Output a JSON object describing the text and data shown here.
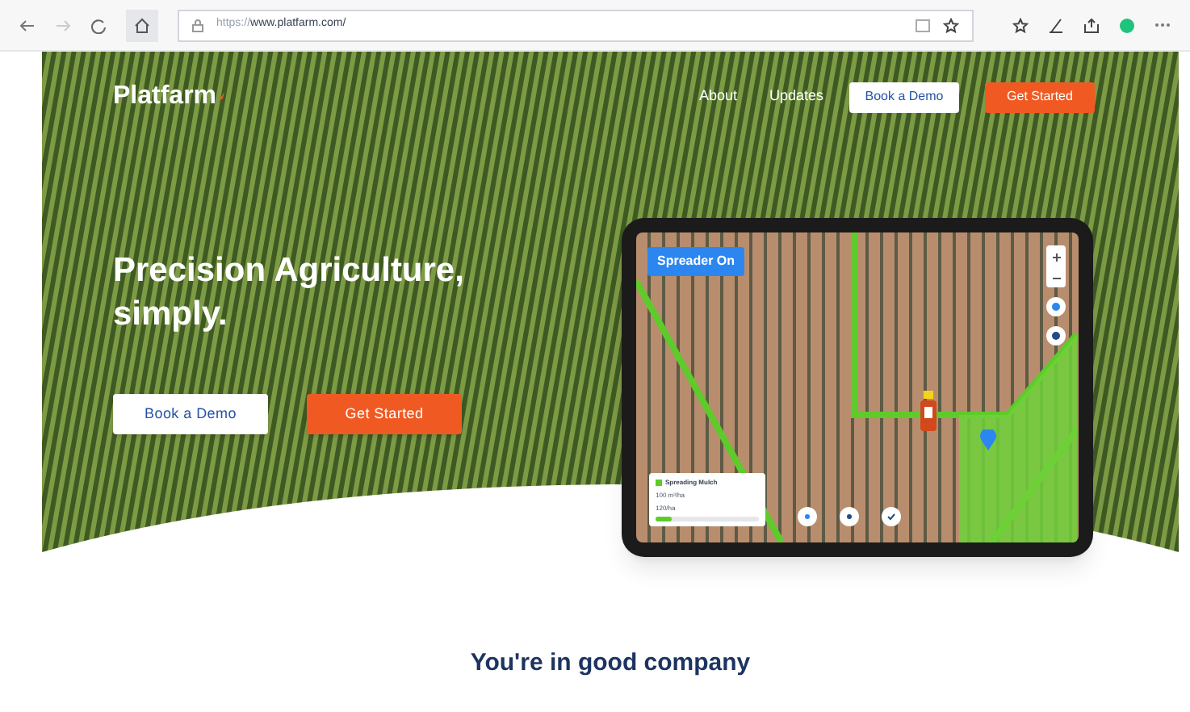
{
  "browser": {
    "url_prefix": "https://",
    "url_domain": "www.platfarm.com/"
  },
  "nav": {
    "logo": "Platfarm",
    "links": [
      {
        "label": "About"
      },
      {
        "label": "Updates"
      }
    ],
    "buttons": [
      {
        "label": "Book a Demo",
        "kind": "secondary"
      },
      {
        "label": "Get Started",
        "kind": "primary"
      }
    ]
  },
  "hero": {
    "headline": "Precision Agriculture, simply.",
    "buttons": [
      {
        "label": "Book a Demo",
        "kind": "secondary"
      },
      {
        "label": "Get Started",
        "kind": "primary"
      }
    ]
  },
  "tablet": {
    "status_badge": "Spreader On",
    "card": {
      "title": "Spreading Mulch",
      "rate": "100 m³/ha",
      "progress": "120/ha",
      "level": 0.15
    }
  },
  "section": {
    "heading": "You're in good company"
  }
}
